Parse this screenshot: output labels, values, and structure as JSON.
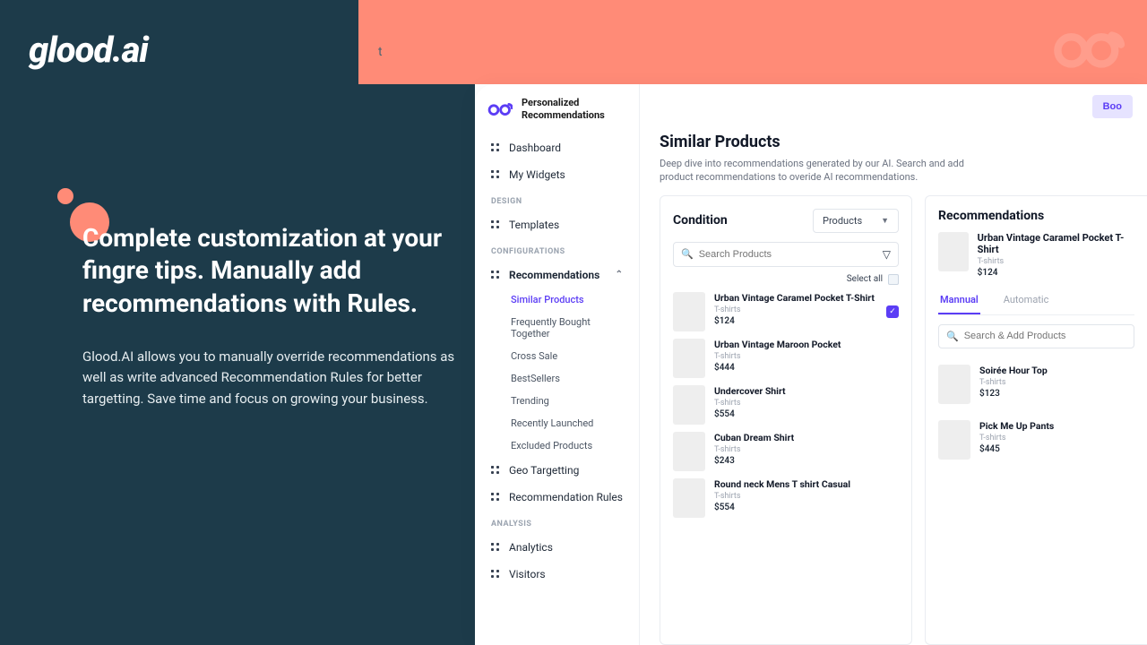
{
  "logo_text": "glood.ai",
  "tiny_t": "t",
  "hero": {
    "title": "Complete customization at your fingre tips. Manually add recommendations with Rules.",
    "body": "Glood.AI allows you to manually override recommendations as well as write advanced Recommendation Rules for better targetting. Save time and focus on growing your business."
  },
  "app_header": {
    "title_line1": "Personalized",
    "title_line2": "Recommendations",
    "book_label": "Boo"
  },
  "sidebar": {
    "main": [
      {
        "label": "Dashboard"
      },
      {
        "label": "My Widgets"
      }
    ],
    "section_design": "DESIGN",
    "design": [
      {
        "label": "Templates"
      }
    ],
    "section_config": "CONFIGURATIONS",
    "config_expanded": "Recommendations",
    "config_sub": [
      {
        "label": "Similar Products",
        "active": true
      },
      {
        "label": "Frequently Bought Together"
      },
      {
        "label": "Cross Sale"
      },
      {
        "label": "BestSellers"
      },
      {
        "label": "Trending"
      },
      {
        "label": "Recently Launched"
      },
      {
        "label": "Excluded Products"
      }
    ],
    "config_rest": [
      {
        "label": "Geo Targetting"
      },
      {
        "label": "Recommendation Rules"
      }
    ],
    "section_analysis": "ANALYSIS",
    "analysis": [
      {
        "label": "Analytics"
      },
      {
        "label": "Visitors"
      }
    ]
  },
  "page": {
    "title": "Similar Products",
    "subtitle": "Deep dive into recommendations generated by our AI. Search and add product recommendations to overide AI recommendations."
  },
  "condition": {
    "title": "Condition",
    "filter_label": "Products",
    "search_placeholder": "Search Products",
    "select_all": "Select all",
    "products": [
      {
        "name": "Urban Vintage Caramel Pocket T-Shirt",
        "cat": "T-shirts",
        "price": "$124",
        "thumb": "th-olive",
        "checked": true
      },
      {
        "name": "Urban Vintage Maroon Pocket",
        "cat": "T-shirts",
        "price": "$444",
        "thumb": "th-maroon"
      },
      {
        "name": "Undercover Shirt",
        "cat": "T-shirts",
        "price": "$554",
        "thumb": "th-navy"
      },
      {
        "name": "Cuban Dream Shirt",
        "cat": "T-shirts",
        "price": "$243",
        "thumb": "th-light"
      },
      {
        "name": "Round neck Mens T shirt Casual",
        "cat": "T-shirts",
        "price": "$554",
        "thumb": "th-skin"
      }
    ]
  },
  "recs": {
    "title": "Recommendations",
    "head_product": {
      "name": "Urban Vintage Caramel Pocket T-Shirt",
      "cat": "T-shirts",
      "price": "$124",
      "thumb": "th-olive"
    },
    "tabs": {
      "manual": "Mannual",
      "auto": "Automatic"
    },
    "search_placeholder": "Search & Add Products",
    "products": [
      {
        "name": "Soirée Hour Top",
        "cat": "T-shirts",
        "price": "$123",
        "thumb": "th-black"
      },
      {
        "name": "Pick Me Up Pants",
        "cat": "T-shirts",
        "price": "$445",
        "thumb": "th-jean"
      }
    ]
  }
}
